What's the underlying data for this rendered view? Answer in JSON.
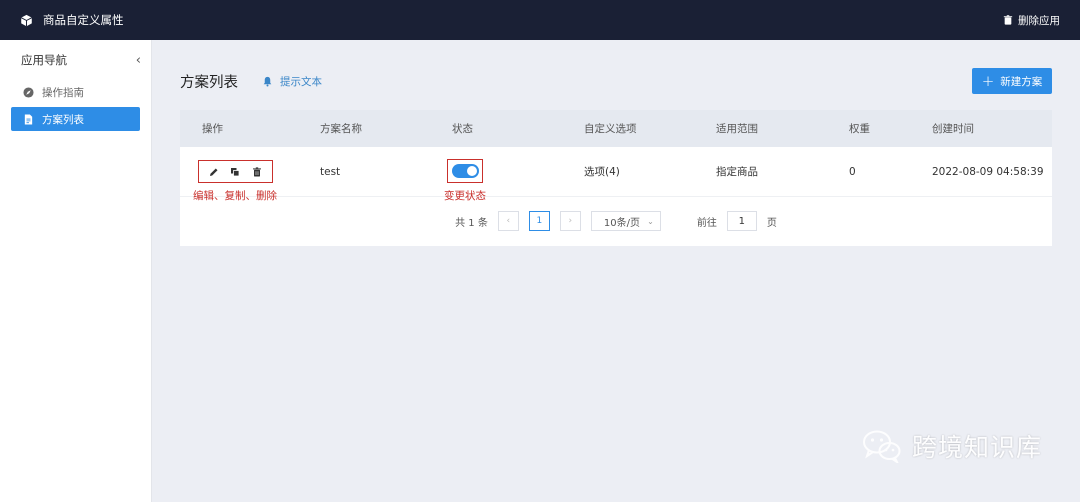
{
  "header": {
    "title": "商品自定义属性",
    "delete_app": "删除应用"
  },
  "sidebar": {
    "title": "应用导航",
    "collapse_glyph": "‹",
    "items": [
      {
        "label": "操作指南",
        "icon": "compass-icon",
        "active": false
      },
      {
        "label": "方案列表",
        "icon": "document-icon",
        "active": true
      }
    ]
  },
  "main": {
    "title": "方案列表",
    "hint": "提示文本",
    "new_button": "新建方案",
    "new_button_glyph": "+"
  },
  "table": {
    "columns": [
      "操作",
      "方案名称",
      "状态",
      "自定义选项",
      "适用范围",
      "权重",
      "创建时间"
    ],
    "rows": [
      {
        "name": "test",
        "status_on": true,
        "options": "选项(4)",
        "scope": "指定商品",
        "weight": "0",
        "created": "2022-08-09 04:58:39"
      }
    ],
    "annotations": {
      "ops": "编辑、复制、删除",
      "status": "变更状态"
    }
  },
  "pagination": {
    "total": "共 1 条",
    "prev": "‹",
    "current_page": "1",
    "next": "›",
    "page_size": "10条/页",
    "goto_label": "前往",
    "goto_value": "1",
    "page_suffix": "页"
  },
  "watermark": "跨境知识库",
  "colors": {
    "accent": "#2e8de6",
    "topbar": "#1a2035",
    "annotation": "#c9302c"
  }
}
